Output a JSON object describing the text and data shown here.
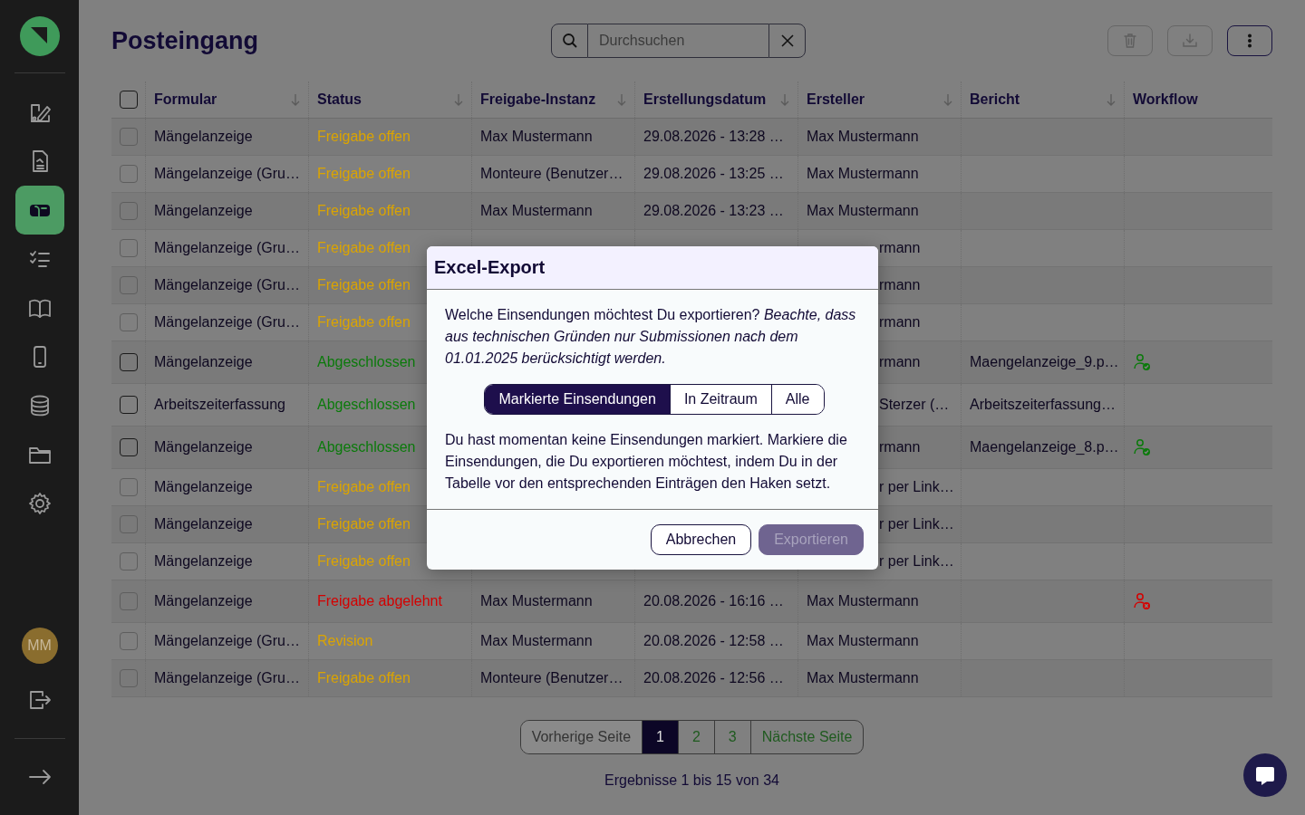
{
  "sidebar": {
    "nav": [
      {
        "kind": "form-edit",
        "selected": false
      },
      {
        "kind": "document",
        "selected": false
      },
      {
        "kind": "inbox",
        "selected": true
      },
      {
        "kind": "checklist",
        "selected": false
      },
      {
        "kind": "book",
        "selected": false
      },
      {
        "kind": "phone",
        "selected": false
      },
      {
        "kind": "database",
        "selected": false
      },
      {
        "kind": "folder",
        "selected": false
      },
      {
        "kind": "settings",
        "selected": false
      }
    ],
    "avatar": "MM"
  },
  "page": {
    "title": "Posteingang"
  },
  "search": {
    "placeholder": "Durchsuchen"
  },
  "toolbar": [
    {
      "kind": "delete",
      "disabled": true
    },
    {
      "kind": "download",
      "disabled": true
    },
    {
      "kind": "more",
      "disabled": false
    }
  ],
  "table": {
    "select_all": {
      "checked": false
    },
    "columns": [
      {
        "label": "Formular",
        "sortable": true
      },
      {
        "label": "Status",
        "sortable": true
      },
      {
        "label": "Freigabe-Instanz",
        "sortable": true
      },
      {
        "label": "Erstellungsdatum",
        "sortable": true
      },
      {
        "label": "Ersteller",
        "sortable": true
      },
      {
        "label": "Bericht",
        "sortable": true
      },
      {
        "label": "Workflow",
        "sortable": false
      }
    ],
    "rows": [
      {
        "checked": false,
        "formular": "Mängelanzeige",
        "status": "Freigabe offen",
        "color": "#dba400",
        "freigabe": "Max Mustermann",
        "datum": "29.08.2026 - 13:28 …",
        "ersteller": "Max Mustermann"
      },
      {
        "checked": false,
        "formular": "Mängelanzeige (Gru…",
        "status": "Freigabe offen",
        "color": "#dba400",
        "freigabe": "Monteure (Benutzer…",
        "datum": "29.08.2026 - 13:25 …",
        "ersteller": "Max Mustermann"
      },
      {
        "checked": false,
        "formular": "Mängelanzeige",
        "status": "Freigabe offen",
        "color": "#dba400",
        "freigabe": "Max Mustermann",
        "datum": "29.08.2026 - 13:23 …",
        "ersteller": "Max Mustermann"
      },
      {
        "checked": false,
        "formular": "Mängelanzeige (Gru…",
        "status": "Freigabe offen",
        "color": "#dba400",
        "ersteller": "rmann"
      },
      {
        "checked": false,
        "formular": "Mängelanzeige (Gru…",
        "status": "Freigabe offen",
        "color": "#dba400",
        "ersteller": "rmann"
      },
      {
        "checked": false,
        "formular": "Mängelanzeige (Gru…",
        "status": "Freigabe offen",
        "color": "#dba400",
        "ersteller": "rmann"
      },
      {
        "checked": false,
        "formular": "Mängelanzeige",
        "status": "Abgeschlossen",
        "color": "#0b7a0b",
        "ersteller": "rmann",
        "bericht": "Maengelanzeige_9.p…",
        "workflow": {
          "kind": "approved"
        }
      },
      {
        "checked": false,
        "formular": "Arbeitszeiterfassung",
        "status": "Abgeschlossen",
        "color": "#0b7a0b",
        "ersteller": "Sterzer (…",
        "bericht": "Arbeitszeiterfassung…"
      },
      {
        "checked": false,
        "formular": "Mängelanzeige",
        "status": "Abgeschlossen",
        "color": "#0b7a0b",
        "ersteller": "rmann",
        "bericht": "Maengelanzeige_8.p…",
        "workflow": {
          "kind": "approved"
        }
      },
      {
        "checked": false,
        "formular": "Mängelanzeige",
        "status": "Freigabe offen",
        "color": "#dba400",
        "ersteller": "r per Link…"
      },
      {
        "checked": false,
        "formular": "Mängelanzeige",
        "status": "Freigabe offen",
        "color": "#dba400",
        "ersteller": "r per Link…"
      },
      {
        "checked": false,
        "formular": "Mängelanzeige",
        "status": "Freigabe offen",
        "color": "#dba400",
        "ersteller": "r per Link…"
      },
      {
        "checked": false,
        "formular": "Mängelanzeige",
        "status": "Freigabe abgelehnt",
        "color": "#d40000",
        "freigabe": "Max Mustermann",
        "datum": "20.08.2026 - 16:16 …",
        "ersteller": "Max Mustermann",
        "workflow": {
          "kind": "rejected"
        }
      },
      {
        "checked": false,
        "formular": "Mängelanzeige (Gru…",
        "status": "Revision",
        "color": "#dba400",
        "freigabe": "Max Mustermann",
        "datum": "20.08.2026 - 12:58 …",
        "ersteller": "Max Mustermann"
      },
      {
        "checked": false,
        "formular": "Mängelanzeige (Gru…",
        "status": "Freigabe offen",
        "color": "#dba400",
        "freigabe": "Monteure (Benutzer…",
        "datum": "20.08.2026 - 12:56 …",
        "ersteller": "Max Mustermann"
      }
    ]
  },
  "pagination": {
    "previous": {
      "label": "Vorherige Seite",
      "disabled": true
    },
    "pages": [
      {
        "label": "1",
        "selected": true
      },
      {
        "label": "2",
        "selected": false
      },
      {
        "label": "3",
        "selected": false
      }
    ],
    "next": {
      "label": "Nächste Seite",
      "disabled": false
    },
    "summary": "Ergebnisse 1 bis 15 von 34"
  },
  "dialog": {
    "title": "Excel-Export",
    "intro": "Welche Einsendungen möchtest Du exportieren? *Beachte, dass aus technischen Gründen nur Submissionen nach dem 01.01.2025 berücksichtigt werden.*",
    "options": [
      {
        "label": "Markierte Einsendungen",
        "selected": true
      },
      {
        "label": "In Zeitraum",
        "selected": false
      },
      {
        "label": "Alle",
        "selected": false
      }
    ],
    "message": "Du hast momentan keine Einsendungen markiert. Markiere die Einsendungen, die Du exportieren möchtest, indem Du in der Tabelle vor den entsprechenden Einträgen den Haken setzt.",
    "buttons": [
      {
        "label": "Abbrechen",
        "kind": "secondary",
        "disabled": false
      },
      {
        "label": "Exportieren",
        "kind": "primary",
        "disabled": true
      }
    ]
  }
}
